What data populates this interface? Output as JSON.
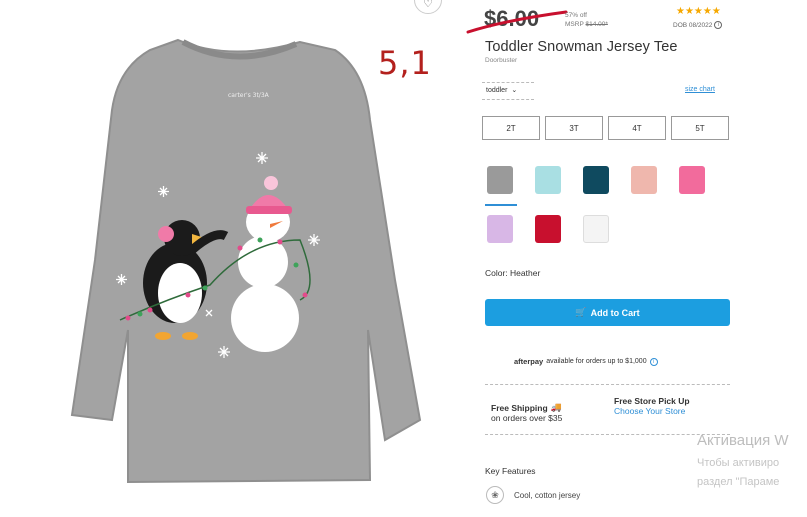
{
  "product": {
    "price": "$6.00",
    "discount": "57% off",
    "msrp_label": "MSRP",
    "msrp_old": "$14.00*",
    "rating_stars": "★★★★★",
    "dob": "DOB 08/2022",
    "title": "Toddler Snowman Jersey Tee",
    "subtitle": "Doorbuster",
    "image_tag": "carter's 3t/3A"
  },
  "annotation": "5,1",
  "size_selector": {
    "dropdown_value": "toddler",
    "size_chart_link": "size chart",
    "sizes": [
      "2T",
      "3T",
      "4T",
      "5T"
    ]
  },
  "swatches": {
    "colors": [
      "#9a9a9a",
      "#a9dfe3",
      "#0f4a5f",
      "#efb7ad",
      "#f26b9c",
      "#d8b7e6",
      "#c8102e",
      "#f4f4f4"
    ],
    "selected_index": 0
  },
  "color_label": "Color: Heather",
  "cart": {
    "add_label": "Add to Cart"
  },
  "afterpay": {
    "brand": "afterpay",
    "text": "available for orders up to $1,000"
  },
  "shipping": {
    "free_shipping_title": "Free Shipping",
    "free_shipping_sub": "on orders over $35",
    "pickup_title": "Free Store Pick Up",
    "pickup_link": "Choose Your Store"
  },
  "key_features": {
    "heading": "Key Features",
    "items": [
      "Cool, cotton jersey"
    ]
  },
  "watermark": {
    "line1": "Активация W",
    "line2": "Чтобы активиро",
    "line3": "раздел \"Параме"
  },
  "icons": {
    "favorite": "heart-icon",
    "cart": "cart-icon",
    "info": "info-icon",
    "feature": "cotton-icon"
  }
}
